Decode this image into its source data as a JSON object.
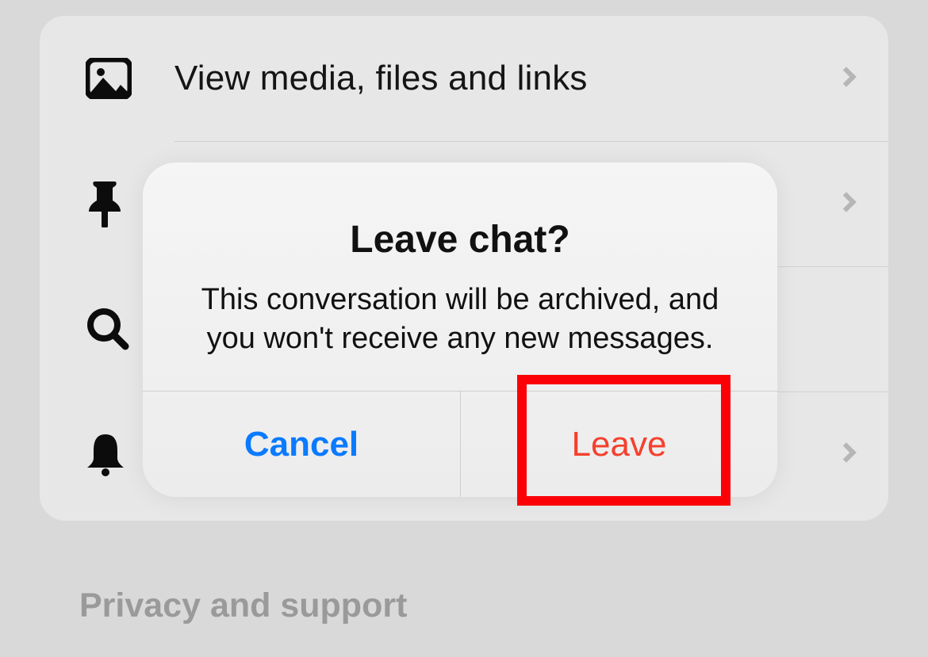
{
  "menu": {
    "items": [
      {
        "label": "View media, files and links"
      },
      {
        "label": ""
      },
      {
        "label": ""
      },
      {
        "label": ""
      }
    ]
  },
  "section": {
    "title": "Privacy and support"
  },
  "dialog": {
    "title": "Leave chat?",
    "message": "This conversation will be archived, and you won't receive any new messages.",
    "cancel_label": "Cancel",
    "leave_label": "Leave"
  }
}
